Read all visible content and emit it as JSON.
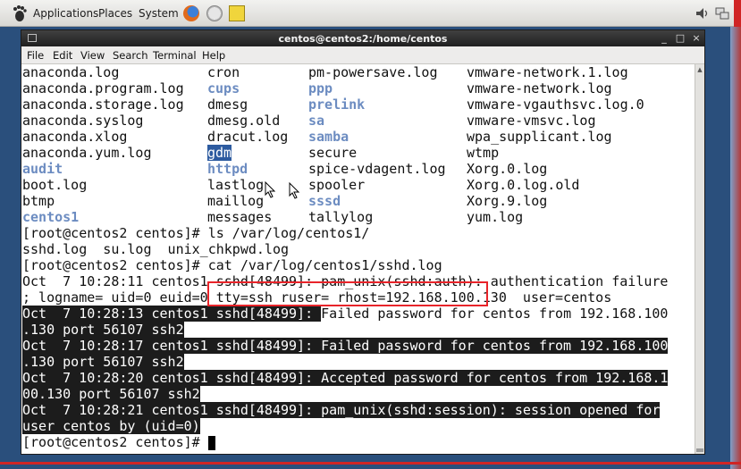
{
  "panel": {
    "applications": "Applications",
    "places": "Places",
    "system": "System",
    "launchers": [
      "firefox-icon",
      "mail-icon",
      "notes-icon"
    ],
    "tray": [
      "volume-icon",
      "network-icon"
    ]
  },
  "window": {
    "title": "centos@centos2:/home/centos",
    "menu": [
      "File",
      "Edit",
      "View",
      "Search",
      "Terminal",
      "Help"
    ]
  },
  "listing": [
    [
      "anaconda.log",
      "cron",
      "pm-powersave.log",
      "vmware-network.1.log"
    ],
    [
      "anaconda.program.log",
      "cups",
      "ppp",
      "vmware-network.log"
    ],
    [
      "anaconda.storage.log",
      "dmesg",
      "prelink",
      "vmware-vgauthsvc.log.0"
    ],
    [
      "anaconda.syslog",
      "dmesg.old",
      "sa",
      "vmware-vmsvc.log"
    ],
    [
      "anaconda.xlog",
      "dracut.log",
      "samba",
      "wpa_supplicant.log"
    ],
    [
      "anaconda.yum.log",
      "gdm",
      "secure",
      "wtmp"
    ],
    [
      "audit",
      "httpd",
      "spice-vdagent.log",
      "Xorg.0.log"
    ],
    [
      "boot.log",
      "lastlog",
      "spooler",
      "Xorg.0.log.old"
    ],
    [
      "btmp",
      "maillog",
      "sssd",
      "Xorg.9.log"
    ],
    [
      "centos1",
      "messages",
      "tallylog",
      "yum.log"
    ]
  ],
  "directories": [
    "cups",
    "ppp",
    "prelink",
    "sa",
    "samba",
    "audit",
    "httpd",
    "sssd",
    "centos1"
  ],
  "selected_entry": "gdm",
  "terminal": {
    "prompt1": "[root@centos2 centos]# ls /var/log/centos1/",
    "ls_output": "sshd.log  su.log  unix_chkpwd.log",
    "prompt2": "[root@centos2 centos]# cat /var/log/centos1/sshd.log",
    "log1a": "Oct  7 10:28:11 centos1 sshd[48499]: pam_unix(sshd:auth): authentication failure",
    "log1b": "; logname= uid=0 euid=0 tty=ssh ruser= rhost=192.168.100.130  user=centos",
    "log2_prefix": "Oct  7 10:28:13 centos1 sshd[48499]: ",
    "log2_hl": "Failed password for centos from 192.168.100",
    "log2b": ".130 port 56107 ssh2",
    "log3a": "Oct  7 10:28:17 centos1 sshd[48499]: Failed password for centos from 192.168.100",
    "log3b": ".130 port 56107 ssh2",
    "log4a": "Oct  7 10:28:20 centos1 sshd[48499]: Accepted password for centos from 192.168.1",
    "log4b": "00.130 port 56107 ssh2",
    "log5a": "Oct  7 10:28:21 centos1 sshd[48499]: pam_unix(sshd:session): session opened for",
    "log5b": "user centos by (uid=0)",
    "prompt3": "[root@centos2 centos]# "
  },
  "colors": {
    "highlight_box": "#e8242a",
    "directory": "#6c8cc1",
    "selection": "#2d5ba0",
    "output_highlight_bg": "#1c1c1c"
  }
}
